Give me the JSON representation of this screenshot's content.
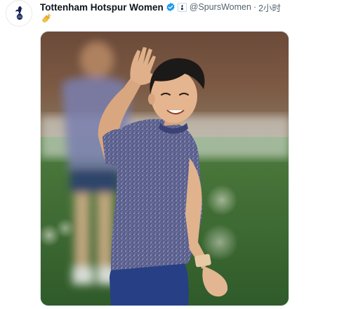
{
  "tweet": {
    "display_name": "Tottenham Hotspur Women",
    "handle": "@SpursWomen",
    "separator": "·",
    "time": "2小时",
    "avatar_icon": "spurs-cockerel-logo",
    "verified_icon": "verified-badge-icon",
    "affiliation_icon": "affiliate-badge-icon",
    "body_emoji": "clapping-hands-emoji",
    "media": {
      "type": "photo",
      "subject": "player-waving"
    }
  },
  "colors": {
    "name_text": "#0f1419",
    "secondary_text": "#536471",
    "verified_blue": "#1d9bf0",
    "border": "#e1e8ed"
  }
}
